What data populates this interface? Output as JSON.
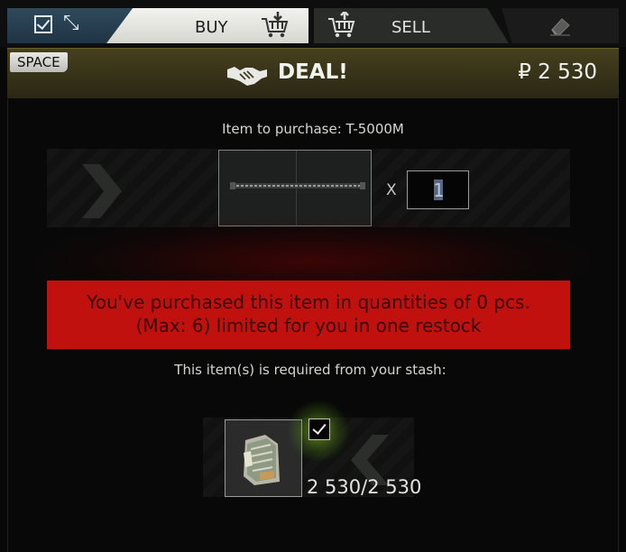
{
  "tabs": {
    "options_icons": [
      "checkbox-icon",
      "collapse-arrows-icon"
    ],
    "buy_label": "BUY",
    "buy_icon": "download-cart-icon",
    "sell_label": "SELL",
    "sell_icon": "upload-cart-icon",
    "clear_icon": "eraser-icon"
  },
  "deal": {
    "key_hint": "SPACE",
    "label": "DEAL!",
    "icon": "handshake-icon",
    "price": "₽ 2 530"
  },
  "purchase": {
    "title": "Item to purchase: T-5000M",
    "quantity_prefix": "X",
    "quantity_value": "1",
    "nav_icon": "chevron-right-icon"
  },
  "warning": {
    "line1": "You've purchased this item in quantities of 0 pcs.",
    "line2": "(Max: 6) limited for you in one restock"
  },
  "requirements": {
    "title": "This item(s) is required from your stash:",
    "item_icon": "roubles-cash-icon",
    "selected": true,
    "count": "2 530/2 530",
    "nav_icon": "chevron-left-icon"
  },
  "colors": {
    "buy_tab": "#e8e8e2",
    "options_tab": "#2a4456",
    "deal_bar": "#3a351a",
    "warning": "#c1110f",
    "warning_text": "#360404",
    "selected_glow": "#96d228"
  }
}
